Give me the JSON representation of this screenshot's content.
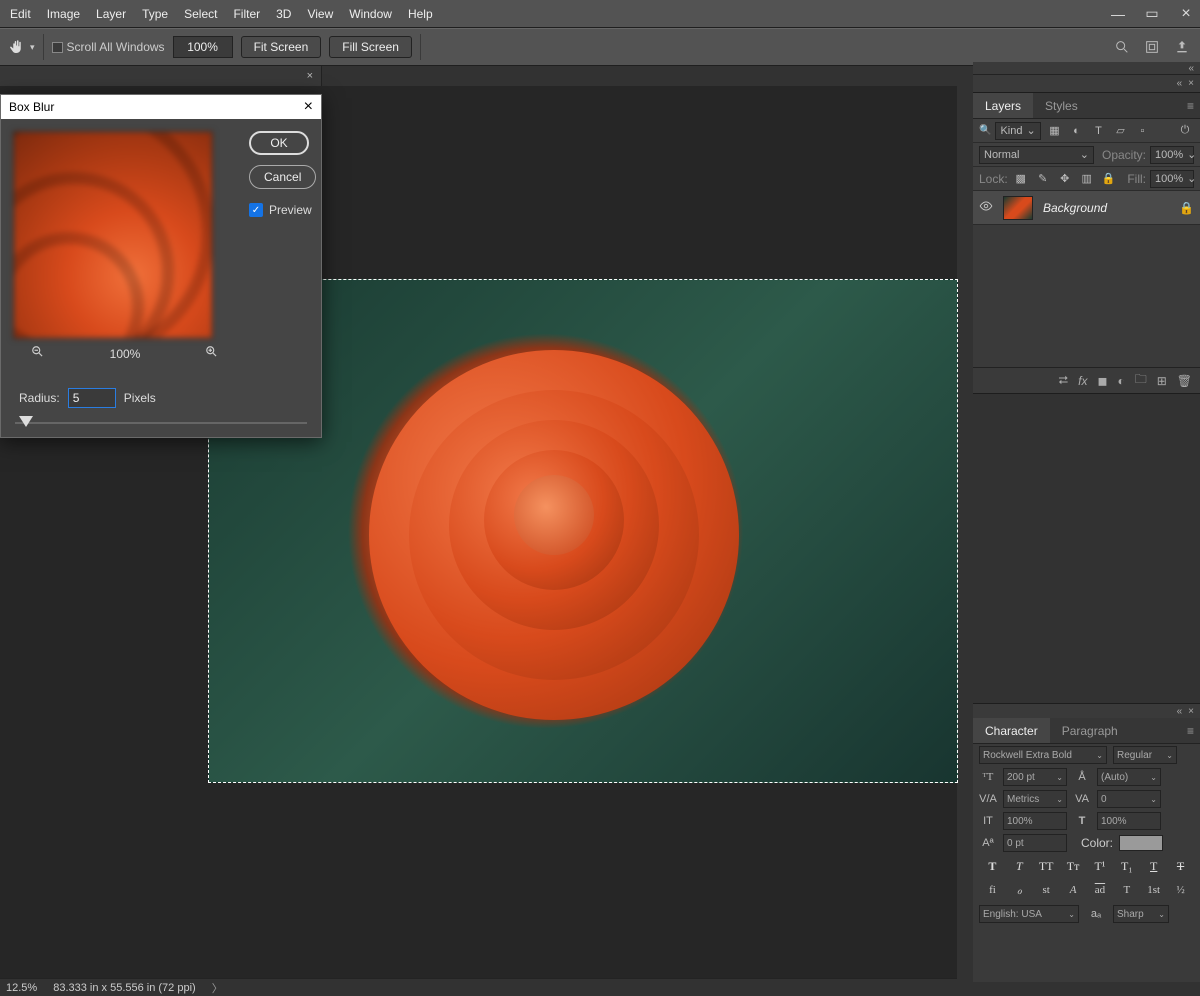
{
  "menu": {
    "items": [
      "Edit",
      "Image",
      "Layer",
      "Type",
      "Select",
      "Filter",
      "3D",
      "View",
      "Window",
      "Help"
    ]
  },
  "options_bar": {
    "scroll_all": "Scroll All Windows",
    "zoom": "100%",
    "fit_screen": "Fit Screen",
    "fill_screen": "Fill Screen"
  },
  "doc_tab_close": "×",
  "dialog": {
    "title": "Box Blur",
    "ok": "OK",
    "cancel": "Cancel",
    "preview": "Preview",
    "zoom": "100%",
    "radius_label": "Radius:",
    "radius_value": "5",
    "units": "Pixels"
  },
  "layers_panel": {
    "tab1": "Layers",
    "tab2": "Styles",
    "kind_label": "Kind",
    "blend_mode": "Normal",
    "opacity_label": "Opacity:",
    "opacity_value": "100%",
    "lock_label": "Lock:",
    "fill_label": "Fill:",
    "fill_value": "100%",
    "layer_name": "Background"
  },
  "character_panel": {
    "tab1": "Character",
    "tab2": "Paragraph",
    "font": "Rockwell Extra Bold",
    "style": "Regular",
    "size": "200 pt",
    "leading": "(Auto)",
    "kerning": "Metrics",
    "tracking": "0",
    "vscale": "100%",
    "hscale": "100%",
    "baseline": "0 pt",
    "color_label": "Color:",
    "lang": "English: USA",
    "aa": "Sharp",
    "style_bold": "T",
    "style_italic": "T",
    "style_caps": "TT",
    "style_small": "Tᴛ",
    "style_sup": "T¹",
    "style_sub": "T₁",
    "style_under": "T",
    "style_strike": "T",
    "ot_fi": "fi",
    "ot_o": "ℴ",
    "ot_st": "st",
    "ot_a": "A",
    "ot_ad": "ad",
    "ot_t": "T",
    "ot_1st": "1st",
    "ot_half": "½"
  },
  "status": {
    "zoom": "12.5%",
    "doc": "83.333 in x 55.556 in (72 ppi)"
  }
}
